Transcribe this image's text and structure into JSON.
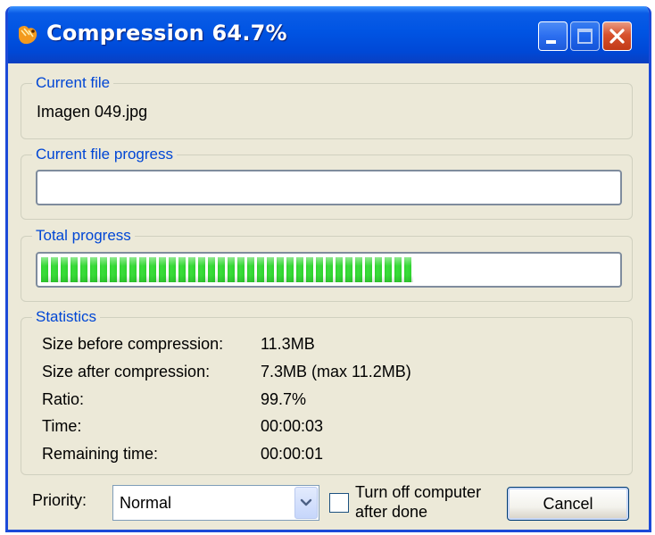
{
  "window": {
    "title": "Compression 64.7%"
  },
  "groups": {
    "current_file_label": "Current file",
    "current_file_progress_label": "Current file progress",
    "total_progress_label": "Total progress",
    "statistics_label": "Statistics"
  },
  "current_file": {
    "name": "Imagen 049.jpg"
  },
  "progress": {
    "current_file_fraction": 0.0,
    "total_fraction": 0.647
  },
  "statistics": {
    "rows": [
      {
        "label": "Size before compression:",
        "value": "11.3MB"
      },
      {
        "label": "Size after compression:",
        "value": "7.3MB (max 11.2MB)"
      },
      {
        "label": "Ratio:",
        "value": "99.7%"
      },
      {
        "label": "Time:",
        "value": "00:00:03"
      },
      {
        "label": "Remaining time:",
        "value": "00:00:01"
      }
    ]
  },
  "footer": {
    "priority_label": "Priority:",
    "priority_value": "Normal",
    "turn_off_label": "Turn off computer after done",
    "turn_off_checked": false,
    "cancel_label": "Cancel"
  },
  "colors": {
    "titlebar": "#0054e3",
    "group_label": "#0046d5",
    "progress_green": "#2fd32f",
    "window_bg": "#ece9d8"
  },
  "icons": {
    "app": "shrimp-app-icon",
    "minimize": "minimize-icon",
    "maximize": "maximize-icon",
    "close": "close-icon",
    "dropdown": "chevron-down-icon"
  }
}
